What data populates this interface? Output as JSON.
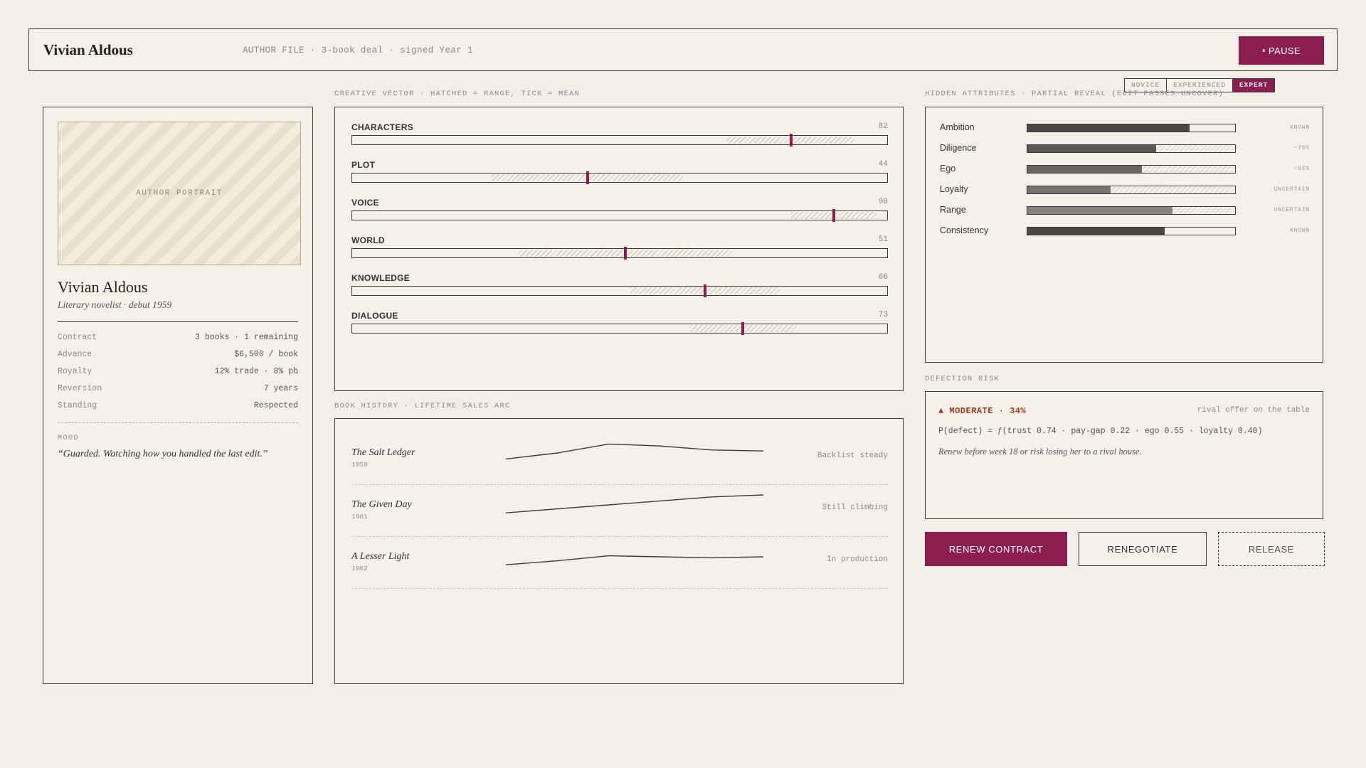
{
  "header": {
    "name": "Vivian Aldous",
    "file_info": "AUTHOR FILE · 3-book deal · signed Year 1",
    "pause_label": "PAUSE",
    "pause_icon": "pause-icon"
  },
  "difficulty": {
    "options": [
      "NOVICE",
      "EXPERIENCED",
      "EXPERT"
    ],
    "selected": "EXPERT"
  },
  "author": {
    "portrait_label": "AUTHOR PORTRAIT",
    "name": "Vivian Aldous",
    "subtitle": "Literary novelist · debut 1959",
    "terms": [
      {
        "key": "Contract",
        "value": "3 books · 1 remaining"
      },
      {
        "key": "Advance",
        "value": "$6,500 / book"
      },
      {
        "key": "Royalty",
        "value": "12% trade · 8% pb"
      },
      {
        "key": "Reversion",
        "value": "7 years"
      },
      {
        "key": "Standing",
        "value": "Respected"
      }
    ],
    "mood_label": "MOOD",
    "mood_quote": "“Guarded. Watching how you handled the last edit.”"
  },
  "creative": {
    "section_label": "CREATIVE VECTOR · HATCHED = RANGE, TICK = MEAN",
    "scale_max": 100,
    "items": [
      {
        "label": "CHARACTERS",
        "value": 82,
        "range": [
          70,
          94
        ]
      },
      {
        "label": "PLOT",
        "value": 44,
        "range": [
          26,
          62
        ]
      },
      {
        "label": "VOICE",
        "value": 90,
        "range": [
          82,
          98
        ]
      },
      {
        "label": "WORLD",
        "value": 51,
        "range": [
          31,
          71
        ]
      },
      {
        "label": "KNOWLEDGE",
        "value": 66,
        "range": [
          52,
          80
        ]
      },
      {
        "label": "DIALOGUE",
        "value": 73,
        "range": [
          63,
          83
        ]
      }
    ]
  },
  "hidden": {
    "section_label": "HIDDEN ATTRIBUTES · PARTIAL REVEAL (EDIT PASSES UNCOVER)",
    "items": [
      {
        "label": "Ambition",
        "value": 0.78,
        "status": "KNOWN",
        "color": "#4a4744"
      },
      {
        "label": "Diligence",
        "value": 0.62,
        "status": "~70%",
        "color": "#5a5754"
      },
      {
        "label": "Ego",
        "value": 0.55,
        "status": "~55%",
        "color": "#676461"
      },
      {
        "label": "Loyalty",
        "value": 0.4,
        "status": "UNCERTAIN",
        "color": "#76736f"
      },
      {
        "label": "Range",
        "value": 0.7,
        "status": "UNCERTAIN",
        "color": "#86827c"
      },
      {
        "label": "Consistency",
        "value": 0.66,
        "status": "KNOWN",
        "color": "#4a4744"
      }
    ]
  },
  "history": {
    "section_label": "BOOK HISTORY · LIFETIME SALES ARC",
    "books": [
      {
        "title": "The Salt Ledger",
        "year": "1959",
        "status": "Backlist steady",
        "arc": [
          0.2,
          0.5,
          0.95,
          0.85,
          0.65,
          0.6
        ]
      },
      {
        "title": "The Given Day",
        "year": "1961",
        "status": "Still climbing",
        "arc": [
          0.1,
          0.3,
          0.5,
          0.7,
          0.9,
          1.0
        ]
      },
      {
        "title": "A Lesser Light",
        "year": "1962",
        "status": "In production",
        "arc": [
          0.1,
          0.3,
          0.55,
          0.5,
          0.45,
          0.5
        ]
      }
    ]
  },
  "defection": {
    "section_label": "DEFECTION RISK",
    "level": "▲ MODERATE · 34%",
    "note": "rival offer on the table",
    "formula": "P(defect) = ƒ(trust 0.74 · pay-gap 0.22 · ego 0.55 · loyalty 0.40)",
    "advice": "Renew before week 18 or risk losing her to a rival house."
  },
  "actions": {
    "renew": "RENEW CONTRACT",
    "renegotiate": "RENEGOTIATE",
    "release": "RELEASE"
  },
  "colors": {
    "accent": "#8b1e4f",
    "risk": "#9a3a1e",
    "background": "#f3efe7"
  }
}
